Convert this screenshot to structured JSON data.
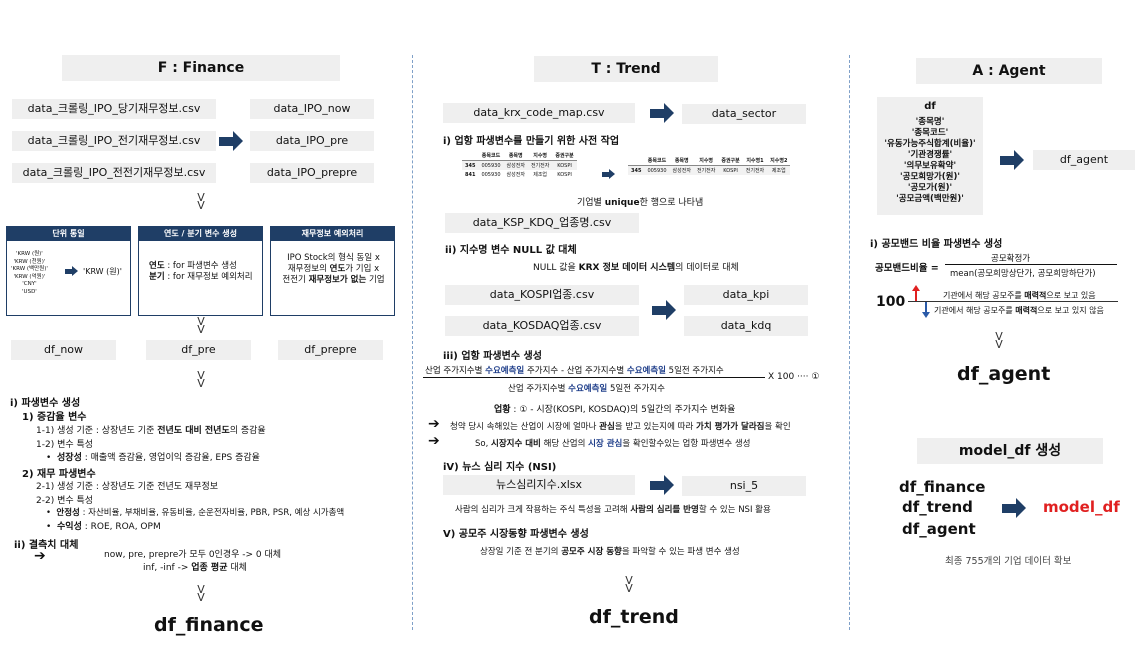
{
  "finance": {
    "header": "F : Finance",
    "files": [
      "data_크롤링_IPO_당기재무정보.csv",
      "data_크롤링_IPO_전기재무정보.csv",
      "data_크롤링_IPO_전전기재무정보.csv"
    ],
    "targets": [
      "data_IPO_now",
      "data_IPO_pre",
      "data_IPO_prepre"
    ],
    "vv": "V\nV",
    "unit_box": {
      "title": "단위 통일",
      "list": "'KRW (원)'\n'KRW (천원)'\n'KRW (백만원)'\n'KRW (억원)'\n'CNY'\n'USD'",
      "result": "'KRW (원)'"
    },
    "year_box": {
      "title": "연도 / 분기 변수 생성",
      "line1_key": "연도",
      "line1_rest": " : for 파생변수 생성",
      "line2_key": "분기",
      "line2_rest": " : for 재무정보 예외처리"
    },
    "exc_box": {
      "title": "재무정보 예외처리",
      "line1": "IPO Stock의 형식 동일 x",
      "line2_pre": "재무정보의 ",
      "line2_b": "연도",
      "line2_post": "가 기입 x",
      "line3_pre": "전전기 ",
      "line3_b": "재무정보가 없는",
      "line3_post": " 기업"
    },
    "dfs": [
      "df_now",
      "df_pre",
      "df_prepre"
    ],
    "s1": "i) 파생변수 생성",
    "s1_1": "1) 증감율 변수",
    "s1_1_1_pre": "1-1) 생성 기준 :  상장년도 기준 ",
    "s1_1_1_b": "전년도 대비 전년도",
    "s1_1_1_post": "의 증감율",
    "s1_1_2": "1-2) 변수 특성",
    "s1_1_2_b": "성장성",
    "s1_1_2_rest": " : 매출액 증감율, 영업이익 증감율, EPS 증감율",
    "s1_2": "2) 재무 파생변수",
    "s1_2_1": "2-1) 생성 기준 : 상장년도 기준 전년도 재무정보",
    "s1_2_2": "2-2) 변수 특성",
    "s1_2_2a_b": "안정성",
    "s1_2_2a_rest": " : 자산비율, 부채비율, 유동비율, 순운전자비율, PBR, PSR, 예상 시가총액",
    "s1_2_2b_b": "수익성",
    "s1_2_2b_rest": " : ROE, ROA, OPM",
    "s2": "ii) 결측치 대체",
    "s2_l1": "now, pre, prepre가 모두 0인경우 -> 0 대체",
    "s2_l2_pre": "inf, -inf -> ",
    "s2_l2_b": "업종 평균",
    "s2_l2_post": " 대체",
    "result": "df_finance"
  },
  "trend": {
    "header": "T : Trend",
    "krx_file": "data_krx_code_map.csv",
    "sector": "data_sector",
    "s1": "i) 업항 파생변수를 만들기 위한 사전 작업",
    "t1_head": [
      "종목코드",
      "종목명",
      "지수명",
      "증권구분"
    ],
    "t1_rows": [
      [
        "345",
        "005930",
        "삼성전자",
        "전기전자",
        "KOSPI"
      ],
      [
        "841",
        "005930",
        "삼성전자",
        "제조업",
        "KOSPI"
      ]
    ],
    "t2_head": [
      "종목코드",
      "종목명",
      "지수명",
      "증권구분",
      "지수명1",
      "지수명2"
    ],
    "t2_rows": [
      [
        "345",
        "005930",
        "삼성전자",
        "전기전자",
        "KOSPI",
        "전기전자",
        "제조업"
      ]
    ],
    "unique_pre": "기업별 ",
    "unique_b": "unique",
    "unique_post": "한 행으로 나타냄",
    "ksp_file": "data_KSP_KDQ_업종명.csv",
    "s2": "ii) 지수명 변수 NULL 값 대체",
    "s2_pre": "NULL 값을 ",
    "s2_b": "KRX 정보 데이터 시스템",
    "s2_post": "의 데이터로 대체",
    "kospi_file": "data_KOSPI업종.csv",
    "kosdaq_file": "data_KOSDAQ업종.csv",
    "kpi": "data_kpi",
    "kdq": "data_kdq",
    "s3": "iii) 업항 파생변수 생성",
    "num_a": "산업 주가지수별 ",
    "num_b": "수요예측일",
    "num_c": " 주가지수 -  산업 주가지수별 ",
    "num_d": "수요예측일",
    "num_e": " 5일전 주가지수",
    "den_a": "산업 주가지수별 ",
    "den_b": "수요예측일",
    "den_c": " 5일전 주가지수",
    "x100": "X 100  ···· ①",
    "upjong_b": "업황",
    "upjong_rest": " : ① - 시장(KOSPI, KOSDAQ)의 5일간의 주가지수 변화율",
    "arr1_pre": "청약 당시 속해있는 산업이 시장에 얼마나 ",
    "arr1_b1": "관심",
    "arr1_mid": "을 받고 있는지에 따라 ",
    "arr1_b2": "가치 평가가 달라짐",
    "arr1_post": "을 확인",
    "arr2_pre": "So, ",
    "arr2_b1": "시장지수 대비",
    "arr2_mid": " 해당 산업의 ",
    "arr2_b2": "시장 관심",
    "arr2_post": "을 확인할수있는  업항 파생변수 생성",
    "s4": "iV) 뉴스 심리 지수 (NSI)",
    "nsi_file": "뉴스심리지수.xlsx",
    "nsi": "nsi_5",
    "nsi_desc_pre": "사람의 심리가 크게 작용하는 주식 특성을 고려해 ",
    "nsi_desc_b": "사람의 심리를 반영",
    "nsi_desc_post": "할 수 있는 NSI 활용",
    "s5": "V) 공모주 시장동향 파생변수 생성",
    "s5_pre": "상장일 기준 전 분기의 ",
    "s5_b": "공모주 시장 동향",
    "s5_post": "을 파악할 수 있는 파생 변수 생성",
    "result": "df_trend"
  },
  "agent": {
    "header": "A : Agent",
    "df": "df",
    "cols": [
      "'종목명'",
      "'종목코드'",
      "'유동가능주식합계(비율)'",
      "'기관경쟁률'",
      "'의무보유확약'",
      "'공모희망가(원)'",
      "'공모가(원)'",
      "'공모금액(백만원)'"
    ],
    "df_agent_box": "df_agent",
    "s1": "i) 공모밴드 비율 파생변수 생성",
    "formula_lhs": "공모밴드비율 =",
    "formula_num": "공모확정가",
    "formula_den": "mean(공모희망상단가, 공모희망하단가)",
    "hundred": "100",
    "up_pre": "기관에서 해당 공모주를 ",
    "up_b": "매력적",
    "up_post": "으로 보고 있음",
    "down_pre": "기관에서 해당 공모주를 ",
    "down_b": "매력적",
    "down_post": "으로 보고 있지 않음",
    "result": "df_agent"
  },
  "model": {
    "header": "model_df 생성",
    "inputs": [
      "df_finance",
      "df_trend",
      "df_agent"
    ],
    "output": "model_df",
    "note": "최종 755개의 기업 데이터 확보"
  },
  "colors": {
    "navy": "#1f3e66",
    "box_gray": "#efefef",
    "red": "#e02020",
    "up_arrow": "#e02020",
    "down_arrow": "#2a5aa8"
  }
}
